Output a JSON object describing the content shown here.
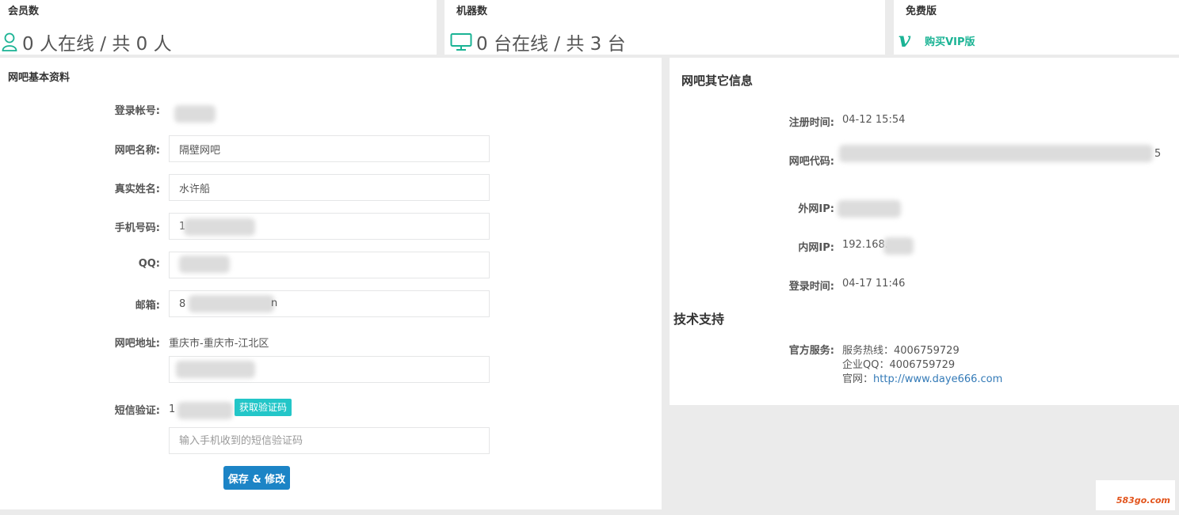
{
  "stats": {
    "members": {
      "title": "会员数",
      "value": "0 人在线 / 共 0 人",
      "icon": "user-icon"
    },
    "machines": {
      "title": "机器数",
      "value": "0 台在线 / 共 3 台",
      "icon": "monitor-icon"
    },
    "version": {
      "title": "免费版",
      "logo": "v",
      "link": "购买VIP版"
    }
  },
  "basic": {
    "title": "网吧基本资料",
    "fields": {
      "account": {
        "label": "登录帐号:"
      },
      "name": {
        "label": "网吧名称:",
        "value": "隔壁网吧"
      },
      "realname": {
        "label": "真实姓名:",
        "value": "水许船"
      },
      "phone": {
        "label": "手机号码:",
        "value": "1"
      },
      "qq": {
        "label": "QQ:"
      },
      "email": {
        "label": "邮箱:",
        "value": "8",
        "suffix": "n"
      },
      "address": {
        "label": "网吧地址:",
        "value": "重庆市-重庆市-江北区"
      },
      "sms": {
        "label": "短信验证:",
        "phone_prefix": "1",
        "button": "获取验证码",
        "placeholder": "输入手机收到的短信验证码"
      }
    },
    "save_button": "保存 & 修改"
  },
  "other": {
    "title": "网吧其它信息",
    "rows": {
      "regtime": {
        "label": "注册时间:",
        "value": "04-12 15:54"
      },
      "code": {
        "label": "网吧代码:",
        "suffix": "5"
      },
      "wan_ip": {
        "label": "外网IP:"
      },
      "lan_ip": {
        "label": "内网IP:",
        "value": "192.168."
      },
      "logintime": {
        "label": "登录时间:",
        "value": "04-17 11:46"
      }
    }
  },
  "support": {
    "title": "技术支持",
    "label": "官方服务:",
    "hotline": "服务热线：4006759729",
    "qq": "企业QQ：4006759729",
    "site_prefix": "官网：",
    "site_url": "http://www.daye666.com"
  },
  "watermark": "583go.com",
  "colors": {
    "accent": "#1ab394",
    "primary": "#1c84c6",
    "info": "#23c6c8",
    "link": "#337ab7"
  }
}
